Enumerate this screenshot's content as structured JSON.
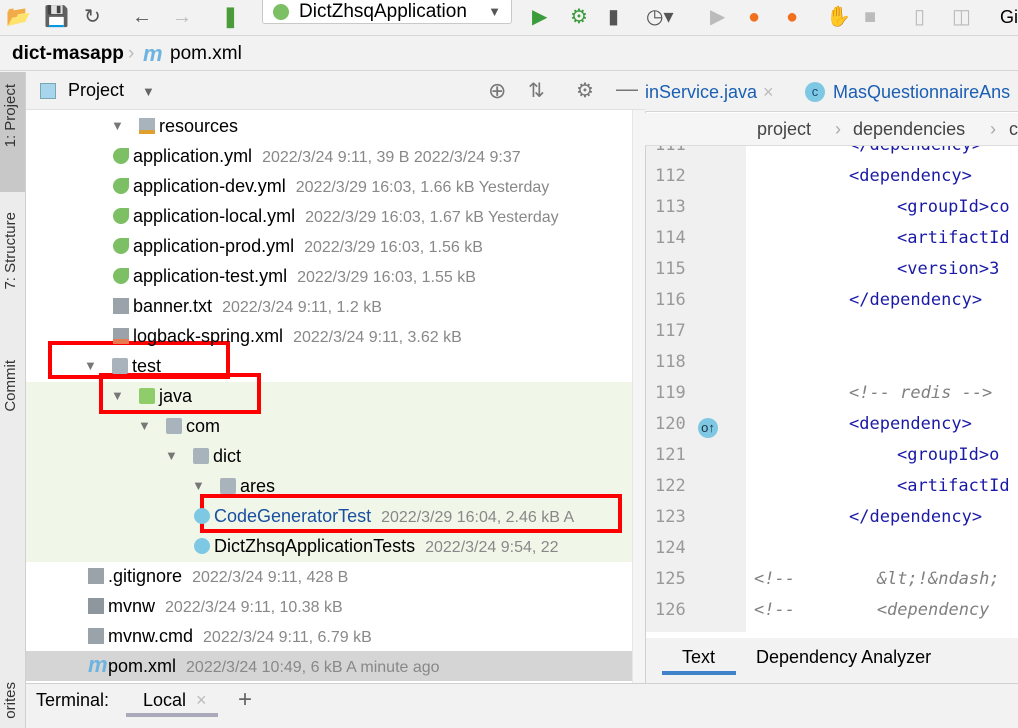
{
  "toolbar": {
    "run_config": "DictZhsqApplication",
    "right_label": "Gi"
  },
  "breadcrumb": {
    "project": "dict-masapp",
    "file": "pom.xml"
  },
  "left_strip": {
    "project": "1: Project",
    "structure": "7: Structure",
    "commit": "Commit",
    "favorites": "orites"
  },
  "project_panel": {
    "title": "Project"
  },
  "tree": [
    {
      "name": "resources",
      "type": "folder-res",
      "depth": 3,
      "open": true,
      "meta": ""
    },
    {
      "name": "application.yml",
      "type": "spring",
      "depth": 4,
      "meta": "2022/3/24 9:11, 39 B 2022/3/24 9:37"
    },
    {
      "name": "application-dev.yml",
      "type": "spring",
      "depth": 4,
      "meta": "2022/3/29 16:03, 1.66 kB Yesterday"
    },
    {
      "name": "application-local.yml",
      "type": "spring",
      "depth": 4,
      "meta": "2022/3/29 16:03, 1.67 kB Yesterday"
    },
    {
      "name": "application-prod.yml",
      "type": "spring",
      "depth": 4,
      "meta": "2022/3/29 16:03, 1.56 kB"
    },
    {
      "name": "application-test.yml",
      "type": "spring",
      "depth": 4,
      "meta": "2022/3/29 16:03, 1.55 kB"
    },
    {
      "name": "banner.txt",
      "type": "text",
      "depth": 4,
      "meta": "2022/3/24 9:11, 1.2 kB"
    },
    {
      "name": "logback-spring.xml",
      "type": "xml",
      "depth": 4,
      "meta": "2022/3/24 9:11, 3.62 kB"
    },
    {
      "name": "test",
      "type": "folder",
      "depth": 2,
      "open": true,
      "meta": ""
    },
    {
      "name": "java",
      "type": "folder-green",
      "depth": 3,
      "open": true,
      "meta": ""
    },
    {
      "name": "com",
      "type": "package",
      "depth": 4,
      "open": true,
      "meta": ""
    },
    {
      "name": "dict",
      "type": "package",
      "depth": 5,
      "open": true,
      "meta": ""
    },
    {
      "name": "ares",
      "type": "package",
      "depth": 6,
      "open": true,
      "meta": ""
    },
    {
      "name": "CodeGeneratorTest",
      "type": "class",
      "depth": 7,
      "meta": "2022/3/29 16:04, 2.46 kB A",
      "blue": true
    },
    {
      "name": "DictZhsqApplicationTests",
      "type": "class",
      "depth": 7,
      "meta": "2022/3/24 9:54, 22"
    },
    {
      "name": ".gitignore",
      "type": "ignore",
      "depth": 2,
      "meta": "2022/3/24 9:11, 428 B"
    },
    {
      "name": "mvnw",
      "type": "shell",
      "depth": 2,
      "meta": "2022/3/24 9:11, 10.38 kB"
    },
    {
      "name": "mvnw.cmd",
      "type": "text",
      "depth": 2,
      "meta": "2022/3/24 9:11, 6.79 kB"
    },
    {
      "name": "pom.xml",
      "type": "maven",
      "depth": 2,
      "meta": "2022/3/24 10:49, 6 kB A minute ago"
    }
  ],
  "editor": {
    "tabs": [
      "inService.java",
      "MasQuestionnaireAns"
    ],
    "crumbs": [
      "project",
      "dependencies",
      "c"
    ],
    "lines": [
      {
        "n": "111",
        "t": "</dependency>",
        "indent": 4,
        "cls": ""
      },
      {
        "n": "112",
        "t": "<dependency>",
        "indent": 4,
        "cls": ""
      },
      {
        "n": "113",
        "t": "<groupId>co",
        "indent": 8,
        "cls": ""
      },
      {
        "n": "114",
        "t": "<artifactId",
        "indent": 8,
        "cls": ""
      },
      {
        "n": "115",
        "t": "<version>3",
        "indent": 8,
        "cls": ""
      },
      {
        "n": "116",
        "t": "</dependency>",
        "indent": 4,
        "cls": ""
      },
      {
        "n": "117",
        "t": "",
        "indent": 0,
        "cls": ""
      },
      {
        "n": "118",
        "t": "",
        "indent": 0,
        "cls": ""
      },
      {
        "n": "119",
        "t": "<!-- redis -->",
        "indent": 4,
        "cls": "cm"
      },
      {
        "n": "120",
        "t": "<dependency>",
        "indent": 4,
        "cls": ""
      },
      {
        "n": "121",
        "t": "<groupId>o",
        "indent": 8,
        "cls": ""
      },
      {
        "n": "122",
        "t": "<artifactId",
        "indent": 8,
        "cls": ""
      },
      {
        "n": "123",
        "t": "</dependency>",
        "indent": 4,
        "cls": ""
      },
      {
        "n": "124",
        "t": "",
        "indent": 0,
        "cls": ""
      },
      {
        "n": "125",
        "t": "<!--        &lt;!&ndash;",
        "indent": 0,
        "cls": "cm"
      },
      {
        "n": "126",
        "t": "<!--        <dependency",
        "indent": 0,
        "cls": "cm"
      }
    ],
    "bottom_tabs": [
      "Text",
      "Dependency Analyzer"
    ]
  },
  "terminal": {
    "label": "Terminal:",
    "tab": "Local"
  }
}
